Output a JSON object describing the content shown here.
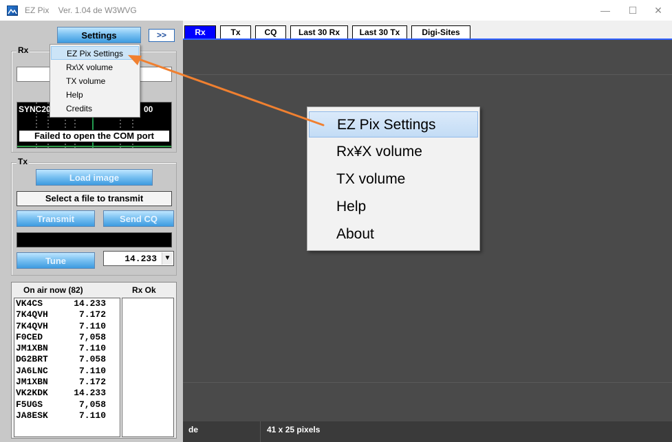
{
  "window": {
    "title": "EZ Pix    Ver. 1.04 de W3WVG",
    "minimize": "—",
    "maximize": "☐",
    "close": "✕"
  },
  "left": {
    "settings_button": "Settings",
    "expand_button": ">>",
    "rx_group_label": "Rx",
    "waterfall_text": "SYNC20",
    "waterfall_text_right": "00",
    "com_error": "Failed to open the COM port",
    "tx_group_label": "Tx",
    "load_image_button": "Load image",
    "select_file_label": "Select a file to transmit",
    "transmit_button": "Transmit",
    "send_cq_button": "Send CQ",
    "tune_button": "Tune",
    "frequency_value": "14.233",
    "on_air_header": "On air now (82)",
    "rx_ok_header": "Rx Ok",
    "on_air": [
      {
        "call": "VK4CS",
        "freq": "14.233"
      },
      {
        "call": "7K4QVH",
        "freq": "7.172"
      },
      {
        "call": "7K4QVH",
        "freq": "7.110"
      },
      {
        "call": "F0CED",
        "freq": "7,058"
      },
      {
        "call": "JM1XBN",
        "freq": "7.110"
      },
      {
        "call": "DG2BRT",
        "freq": "7.058"
      },
      {
        "call": "JA6LNC",
        "freq": "7.110"
      },
      {
        "call": "JM1XBN",
        "freq": "7.172"
      },
      {
        "call": "VK2KDK",
        "freq": "14.233"
      },
      {
        "call": "F5UGS",
        "freq": "7,058"
      },
      {
        "call": "JA8ESK",
        "freq": "7.110"
      }
    ]
  },
  "settings_menu": {
    "items": [
      "EZ Pix Settings",
      "Rx\\X volume",
      "TX volume",
      "Help",
      "Credits"
    ]
  },
  "zoomed_menu": {
    "items": [
      "EZ Pix Settings",
      "Rx¥X volume",
      "TX volume",
      "Help",
      "About"
    ]
  },
  "tabs": [
    "Rx",
    "Tx",
    "CQ",
    "Last 30 Rx",
    "Last 30 Tx",
    "Digi-Sites"
  ],
  "status": {
    "left": "de",
    "right": "41 x 25 pixels"
  },
  "colors": {
    "annotation_arrow": "#f08030",
    "active_tab": "#0000ff"
  }
}
